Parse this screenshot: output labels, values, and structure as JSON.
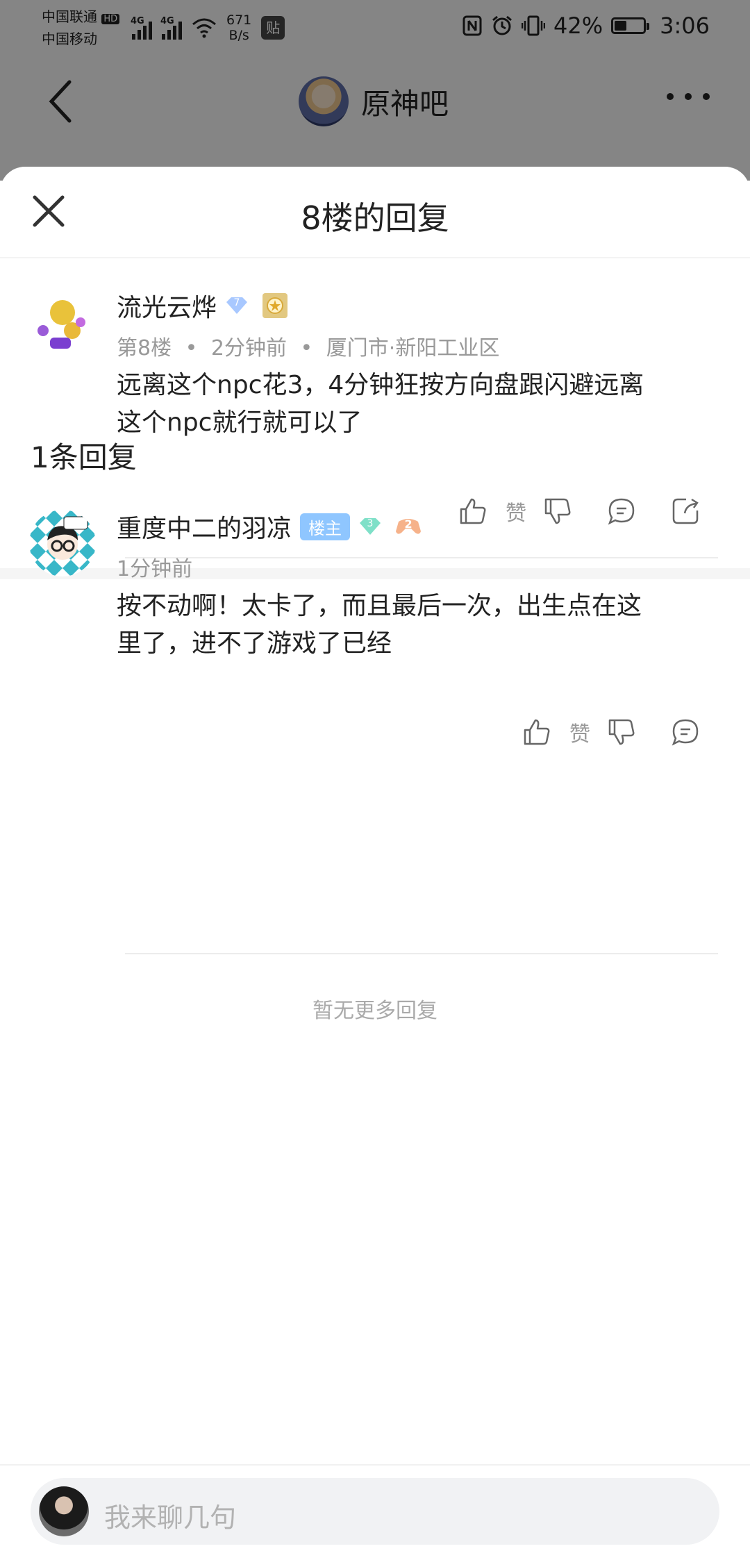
{
  "status_bar": {
    "carrier1": "中国联通",
    "carrier2": "中国移动",
    "hd": "HD",
    "net1": "4G",
    "net2": "4G",
    "speed_value": "671",
    "speed_unit": "B/s",
    "tieba_icon": "贴",
    "battery_pct": "42%",
    "battery_level": 0.42,
    "time": "3:06"
  },
  "top_nav": {
    "title": "原神吧"
  },
  "sheet": {
    "title": "8楼的回复"
  },
  "post": {
    "username": "流光云烨",
    "level": "7",
    "floor": "第8楼",
    "time": "2分钟前",
    "location": "厦门市·新阳工业区",
    "sep": "•",
    "content_line1": "远离这个npc花3，4分钟狂按方向盘跟闪避远离",
    "content_line2": "这个npc就行就可以了",
    "like_label": "赞"
  },
  "replies": {
    "count_label": "1条回复",
    "items": [
      {
        "username": "重度中二的羽凉",
        "owner_tag": "楼主",
        "level": "3",
        "badge": "2",
        "time": "1分钟前",
        "content_line1": "按不动啊！太卡了，而且最后一次，出生点在这",
        "content_line2": "里了，进不了游戏了已经",
        "like_label": "赞"
      }
    ],
    "no_more": "暂无更多回复"
  },
  "input": {
    "placeholder": "我来聊几句"
  },
  "colors": {
    "accent_tag": "#8fc6ff",
    "meta_gray": "#999999",
    "gem_blue": "#a8c8ff",
    "gem_green": "#7fe0c8"
  }
}
